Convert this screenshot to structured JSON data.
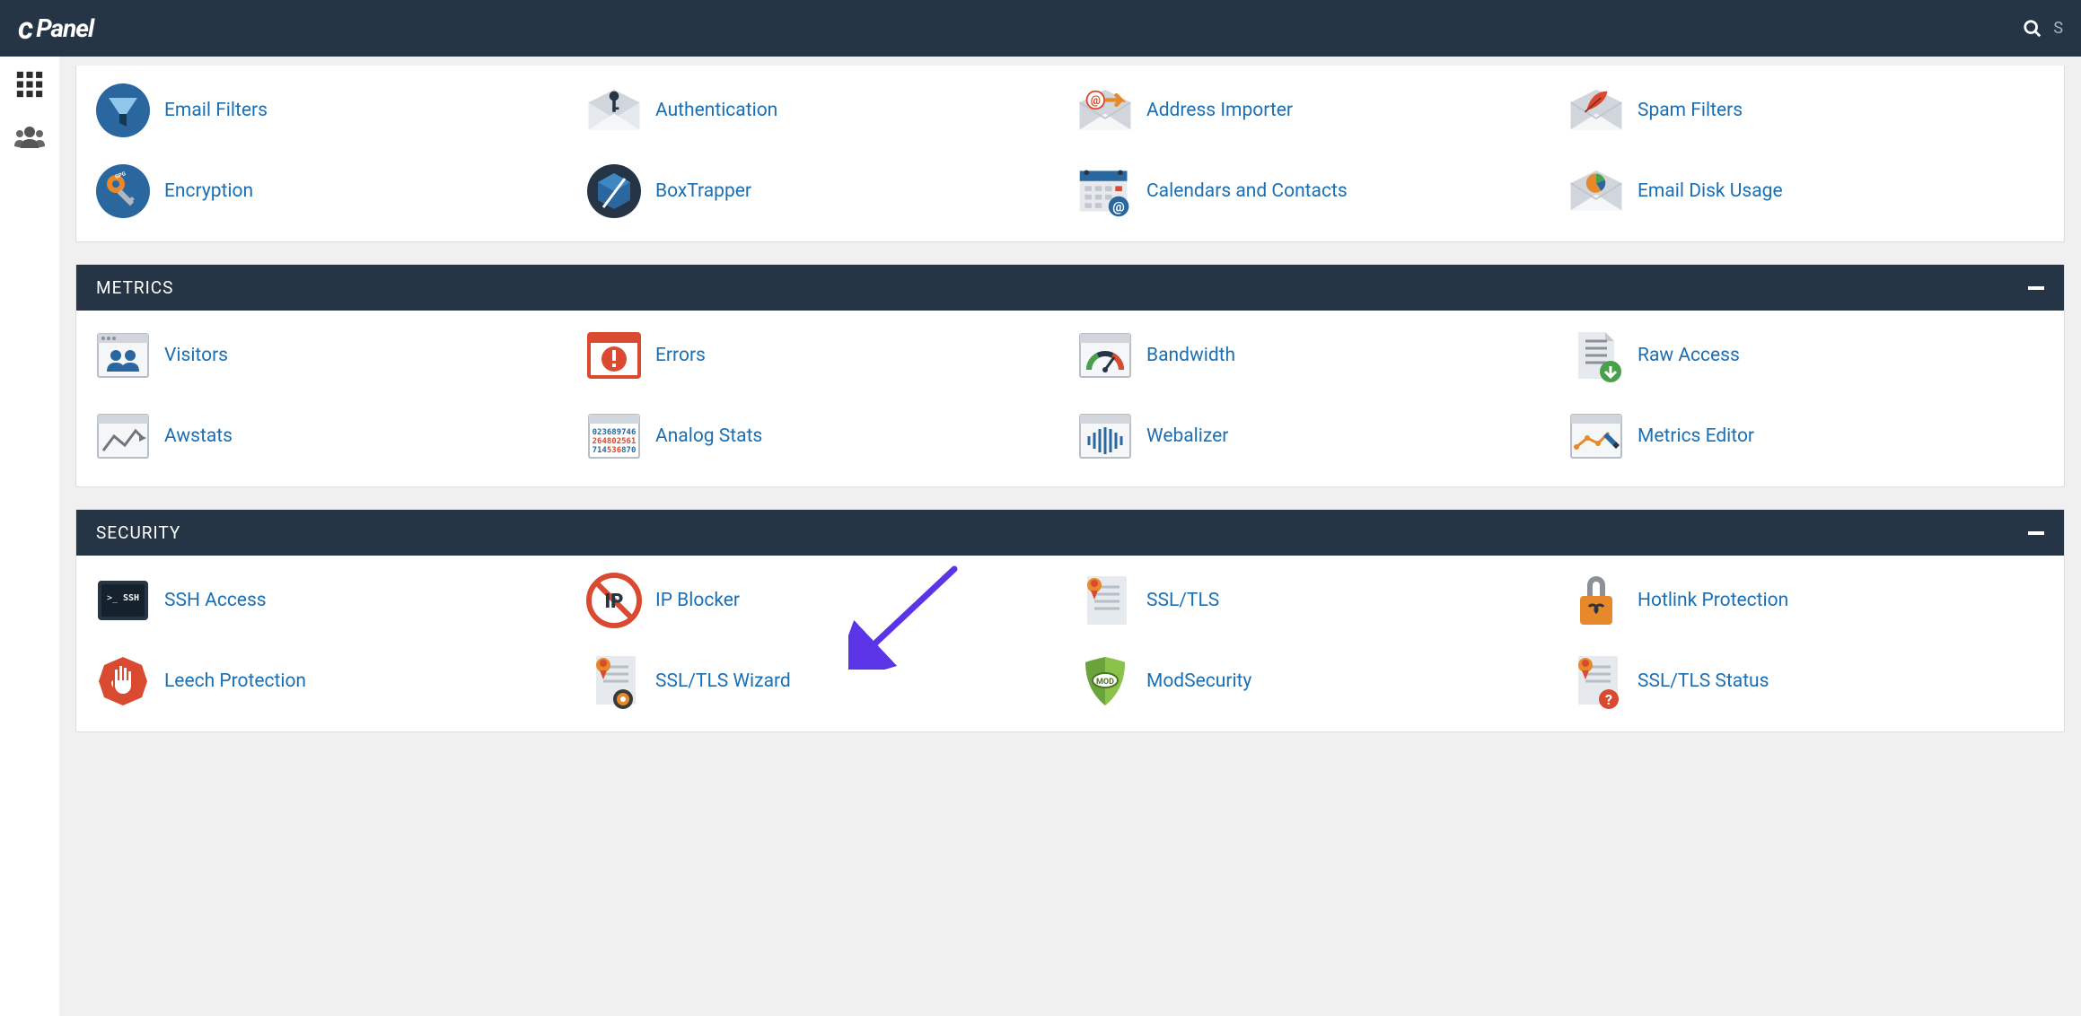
{
  "header": {
    "logo_text": "cPanel",
    "search_placeholder": "S"
  },
  "email_section": {
    "items": [
      {
        "label": "Email Filters",
        "icon": "funnel-icon"
      },
      {
        "label": "Authentication",
        "icon": "envelope-key-icon"
      },
      {
        "label": "Address Importer",
        "icon": "envelope-at-arrow-icon"
      },
      {
        "label": "Spam Filters",
        "icon": "envelope-feather-icon"
      },
      {
        "label": "Encryption",
        "icon": "key-gpg-icon"
      },
      {
        "label": "BoxTrapper",
        "icon": "boxtrapper-icon"
      },
      {
        "label": "Calendars and Contacts",
        "icon": "calendar-at-icon"
      },
      {
        "label": "Email Disk Usage",
        "icon": "envelope-chart-icon"
      }
    ]
  },
  "metrics_section": {
    "title": "METRICS",
    "items": [
      {
        "label": "Visitors",
        "icon": "visitors-icon"
      },
      {
        "label": "Errors",
        "icon": "errors-icon"
      },
      {
        "label": "Bandwidth",
        "icon": "gauge-icon"
      },
      {
        "label": "Raw Access",
        "icon": "document-download-icon"
      },
      {
        "label": "Awstats",
        "icon": "line-chart-icon"
      },
      {
        "label": "Analog Stats",
        "icon": "numbers-icon"
      },
      {
        "label": "Webalizer",
        "icon": "audio-bars-icon"
      },
      {
        "label": "Metrics Editor",
        "icon": "edit-chart-icon"
      }
    ]
  },
  "security_section": {
    "title": "SECURITY",
    "items": [
      {
        "label": "SSH Access",
        "icon": "ssh-terminal-icon"
      },
      {
        "label": "IP Blocker",
        "icon": "ip-block-icon"
      },
      {
        "label": "SSL/TLS",
        "icon": "ssl-cert-icon"
      },
      {
        "label": "Hotlink Protection",
        "icon": "link-lock-icon"
      },
      {
        "label": "Leech Protection",
        "icon": "hand-stop-icon"
      },
      {
        "label": "SSL/TLS Wizard",
        "icon": "ssl-wizard-icon"
      },
      {
        "label": "ModSecurity",
        "icon": "mod-shield-icon"
      },
      {
        "label": "SSL/TLS Status",
        "icon": "ssl-status-icon"
      }
    ]
  }
}
